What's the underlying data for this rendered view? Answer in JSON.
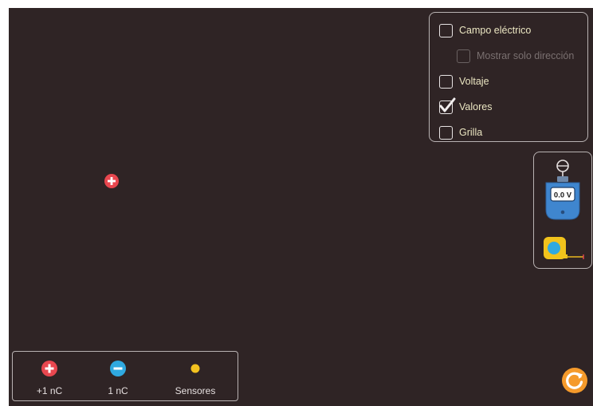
{
  "controls": {
    "electric_field_label": "Campo eléctrico",
    "direction_only_label": "Mostrar solo dirección",
    "voltage_label": "Voltaje",
    "values_label": "Valores",
    "grid_label": "Grilla",
    "electric_field_checked": false,
    "direction_only_checked": false,
    "direction_only_enabled": false,
    "voltage_checked": false,
    "values_checked": true,
    "grid_checked": false
  },
  "tools": {
    "voltmeter_reading": "0.0 V",
    "voltmeter_icon": "voltmeter-icon",
    "tape_icon": "measuring-tape-icon"
  },
  "kit": {
    "positive_label": "+1 nC",
    "negative_label": "1 nC",
    "sensors_label": "Sensores"
  },
  "colors": {
    "background": "#2f2425",
    "positive": "#e8474f",
    "negative": "#2fa9e0",
    "sensor": "#f3c21f",
    "reset": "#f59a2b",
    "panel_border": "#b8b2b2"
  }
}
